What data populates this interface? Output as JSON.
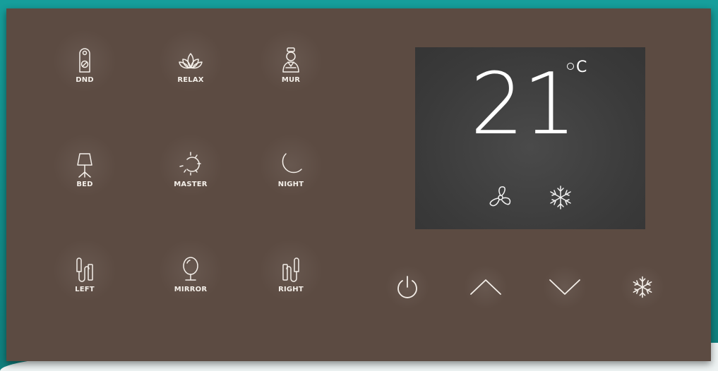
{
  "panel": {
    "buttons": [
      {
        "id": "dnd",
        "label": "DND",
        "icon": "door-hanger-icon"
      },
      {
        "id": "relax",
        "label": "RELAX",
        "icon": "lotus-icon"
      },
      {
        "id": "mur",
        "label": "MUR",
        "icon": "housekeeper-icon"
      },
      {
        "id": "bed",
        "label": "BED",
        "icon": "bed-lamp-icon"
      },
      {
        "id": "master",
        "label": "MASTER",
        "icon": "master-light-icon"
      },
      {
        "id": "night",
        "label": "NIGHT",
        "icon": "moon-icon"
      },
      {
        "id": "left",
        "label": "LEFT",
        "icon": "left-wall-lamp-icon"
      },
      {
        "id": "mirror",
        "label": "MIRROR",
        "icon": "mirror-icon"
      },
      {
        "id": "right",
        "label": "RIGHT",
        "icon": "right-wall-lamp-icon"
      }
    ]
  },
  "thermostat": {
    "temperature": "21",
    "unit": "C",
    "mode_icons": [
      "fan-icon",
      "snowflake-icon"
    ]
  },
  "controls": [
    "power-icon",
    "chevron-up-icon",
    "chevron-down-icon",
    "snowflake-icon"
  ],
  "colors": {
    "panel": "#5c4b42",
    "display": "#3e3e3e",
    "icon": "#f4efe9",
    "background": "#169e9b"
  }
}
